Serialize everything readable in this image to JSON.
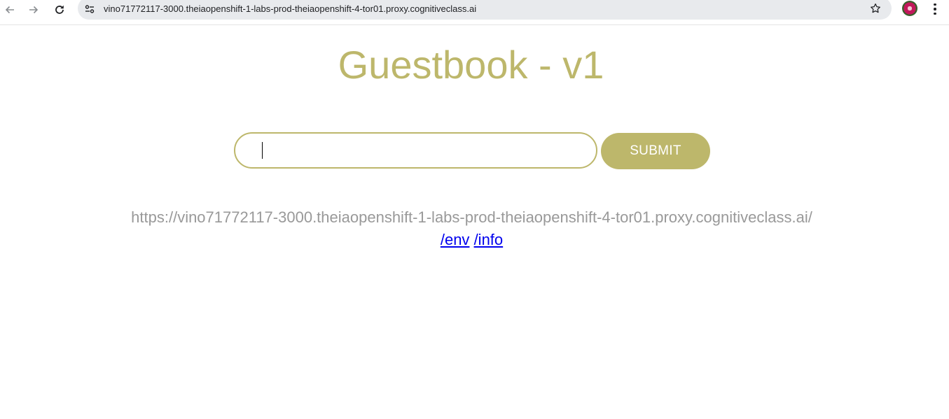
{
  "browser": {
    "url": "vino71772117-3000.theiaopenshift-1-labs-prod-theiaopenshift-4-tor01.proxy.cognitiveclass.ai",
    "icons": {
      "back": "back-arrow-icon",
      "forward": "forward-arrow-icon",
      "reload": "reload-icon",
      "site_info": "site-info-icon",
      "bookmark": "star-icon",
      "profile": "avatar",
      "menu": "kebab-menu-icon"
    }
  },
  "page": {
    "title": "Guestbook - v1",
    "form": {
      "input_value": "",
      "submit_label": "SUBMIT"
    },
    "host_url": "https://vino71772117-3000.theiaopenshift-1-labs-prod-theiaopenshift-4-tor01.proxy.cognitiveclass.ai/",
    "links": [
      {
        "label": "/env"
      },
      {
        "label": "/info"
      }
    ]
  },
  "colors": {
    "accent": "#bdb76b",
    "url_text": "#999999",
    "link": "#0000ee"
  }
}
